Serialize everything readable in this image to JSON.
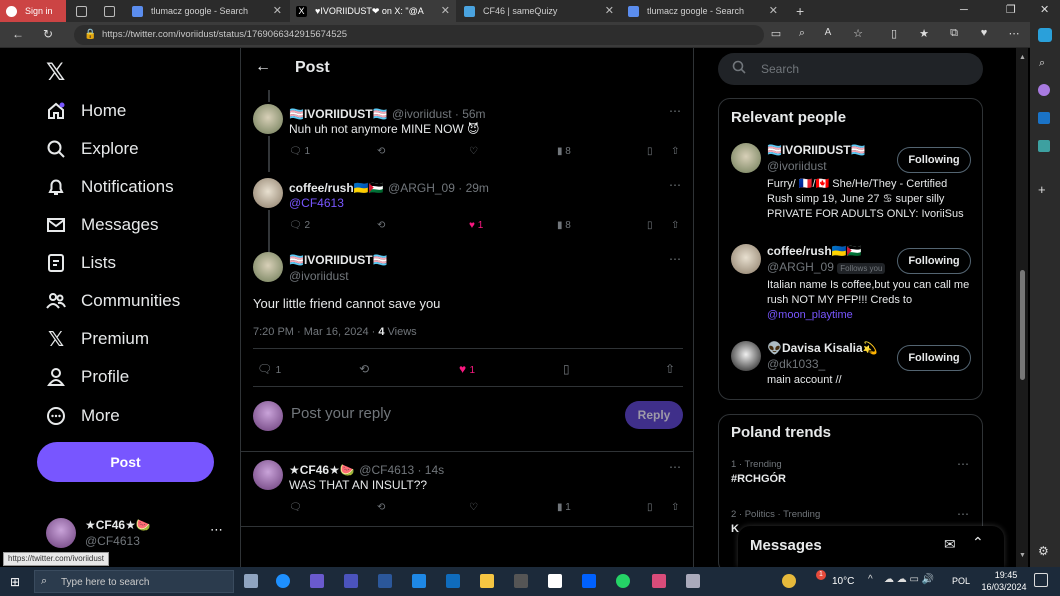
{
  "browser": {
    "tabs": [
      {
        "label": "Sign in"
      },
      {
        "label": "tlumacz google - Search"
      },
      {
        "label": "♥IVORIIDUST❤ on X: \"@A"
      },
      {
        "label": "CF46 | sameQuizy"
      },
      {
        "label": "tlumacz google - Search"
      }
    ],
    "url": "https://twitter.com/ivoriidust/status/1769066342915674525",
    "status_url": "https://twitter.com/ivoriidust"
  },
  "nav": {
    "items": [
      {
        "label": "Home"
      },
      {
        "label": "Explore"
      },
      {
        "label": "Notifications"
      },
      {
        "label": "Messages"
      },
      {
        "label": "Lists"
      },
      {
        "label": "Communities"
      },
      {
        "label": "Premium"
      },
      {
        "label": "Profile"
      },
      {
        "label": "More"
      }
    ],
    "post_button": "Post",
    "account": {
      "name": "★CF46★🍉",
      "handle": "@CF4613"
    }
  },
  "header": {
    "title": "Post"
  },
  "thread": {
    "reply1": {
      "name": "🏳️‍⚧️IVORIIDUST🏳️‍⚧️",
      "meta": "@ivoriidust · 56m",
      "text": "Nuh uh not anymore MINE NOW 😈",
      "replies": "1",
      "likes": "",
      "views": "8"
    },
    "reply2": {
      "name": "coffee/rush🇺🇦🇵🇸",
      "meta": "@ARGH_09 · 29m",
      "text": "@CF4613",
      "replies": "2",
      "likes": "1",
      "views": "8"
    },
    "main": {
      "name": "🏳️‍⚧️IVORIIDUST🏳️‍⚧️",
      "handle": "@ivoriidust",
      "text": "Your little friend cannot save you",
      "time": "7:20 PM · Mar 16, 2024 ·",
      "views_count": "4",
      "views_label": "Views",
      "replies": "1",
      "likes": "1"
    },
    "compose": {
      "placeholder": "Post your reply",
      "button": "Reply"
    },
    "reply3": {
      "name": "★CF46★🍉",
      "meta": "@CF4613 · 14s",
      "text": "WAS THAT AN INSULT??",
      "views": "1"
    }
  },
  "search": {
    "placeholder": "Search"
  },
  "relevant": {
    "title": "Relevant people",
    "people": [
      {
        "name": "🏳️‍⚧️IVORIIDUST🏳️‍⚧️",
        "handle": "@ivoriidust",
        "follows_you": "",
        "bio": "Furry/ 🇫🇷/🇨🇦 She/He/They - Certified Rush simp 19, June 27 ♋ super silly PRIVATE FOR ADULTS ONLY: IvoriiSus",
        "bio_link": "",
        "button": "Following"
      },
      {
        "name": "coffee/rush🇺🇦🇵🇸",
        "handle": "@ARGH_09",
        "follows_you": "Follows you",
        "bio": "Italian name Is coffee,but you can call me rush NOT MY PFP!!! Creds to",
        "bio_link": "@moon_playtime",
        "button": "Following"
      },
      {
        "name": "👽Davisa Kisalia💫",
        "handle": "@dk1033_",
        "follows_you": "",
        "bio": "main account //",
        "bio_link": "",
        "button": "Following"
      }
    ]
  },
  "trends": {
    "title": "Poland trends",
    "items": [
      {
        "meta": "1 · Trending",
        "name": "#RCHGÓR"
      },
      {
        "meta": "2 · Politics · Trending",
        "name": "K"
      }
    ]
  },
  "messages_drawer": {
    "title": "Messages"
  },
  "taskbar": {
    "search_placeholder": "Type here to search",
    "weather": "10°C",
    "lang": "POL",
    "time": "19:45",
    "date": "16/03/2024",
    "weather_badge": "1"
  },
  "colors": {
    "accent": "#7856ff",
    "like": "#f91880",
    "bg": "#000000",
    "border": "#2f3336",
    "muted": "#71767b"
  }
}
